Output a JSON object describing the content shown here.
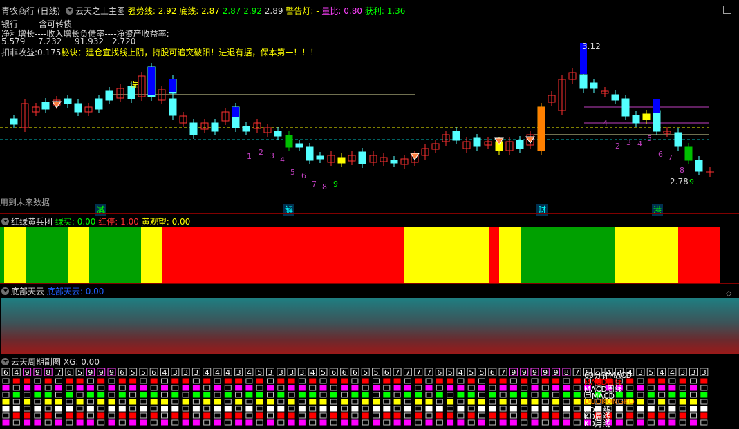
{
  "main": {
    "title": "青农商行 (日线)",
    "indicator_name": "云天之上主图",
    "strong_label": "强势线:",
    "strong_value": "2.92",
    "bottom_label": "底线:",
    "bottom_value": "2.87",
    "extra_values": [
      "2.87",
      "2.92",
      "2.89"
    ],
    "warning_label": "警告灯:",
    "warning_value": "-",
    "volume_ratio_label": "量比:",
    "volume_ratio_value": "0.80",
    "profit_label": "获利:",
    "profit_value": "1.36",
    "info_row1": [
      "银行",
      "含可转债"
    ],
    "info_row2": [
      "净利增长----收入增长",
      "负债率----净资产收益率:"
    ],
    "info_row3": [
      "5.579",
      "7.232",
      "91.932",
      "2.720"
    ],
    "tip_label": "扣非收益:",
    "tip_value": "0.175",
    "tip_text": "秘诀：建仓宜找线上阴，持股可追突破阳！进退有据，保本第一！！！",
    "wash_label": "洗",
    "high_label": "3.12",
    "low_label": "2.78",
    "future_text": "用到未来数据",
    "bottom_tags": [
      "减",
      "解",
      "财",
      "港"
    ],
    "count_labels_left": [
      "1",
      "2",
      "3",
      "4",
      "5",
      "6",
      "7",
      "8",
      "9"
    ],
    "count_labels_right": [
      "2",
      "3",
      "4",
      "5",
      "6",
      "7",
      "8",
      "9"
    ],
    "count_label_mid": "4"
  },
  "panel2": {
    "title": "红绿黄兵团",
    "buy_label": "绿买:",
    "buy_value": "0.00",
    "stop_label": "红停:",
    "stop_value": "1.00",
    "watch_label": "黄观望:",
    "watch_value": "0.00"
  },
  "panel3": {
    "title": "底部天云",
    "series_label": "底部天云:",
    "series_value": "0.00"
  },
  "panel4": {
    "title": "云天周期副图",
    "xg_label": "XG:",
    "xg_value": "0.00",
    "digits": [
      "6",
      "4",
      "9",
      "9",
      "8",
      "7",
      "6",
      "5",
      "9",
      "9",
      "9",
      "6",
      "5",
      "5",
      "6",
      "4",
      "3",
      "3",
      "3",
      "4",
      "4",
      "4",
      "3",
      "4",
      "5",
      "3",
      "3",
      "3",
      "3",
      "4",
      "5",
      "6",
      "6",
      "6",
      "5",
      "5",
      "6",
      "7",
      "7",
      "7",
      "7",
      "6",
      "5",
      "4",
      "5",
      "5",
      "6",
      "7",
      "9",
      "9",
      "9",
      "9",
      "9",
      "8",
      "7",
      "6",
      "5",
      "4",
      "3",
      "4",
      "3",
      "5",
      "4",
      "4",
      "3",
      "3",
      "3"
    ],
    "legend": [
      "60分钟MACD",
      "MACD日线",
      "MACD周线",
      "月MACD",
      "DUOKONGKD",
      "KD日线",
      "KD周线",
      "KD月线"
    ]
  },
  "colors": {
    "up": "#ff3030",
    "down": "#54ffff",
    "green_band": "#00a000",
    "red_band": "#ff0000",
    "yellow_band": "#ffff00"
  }
}
